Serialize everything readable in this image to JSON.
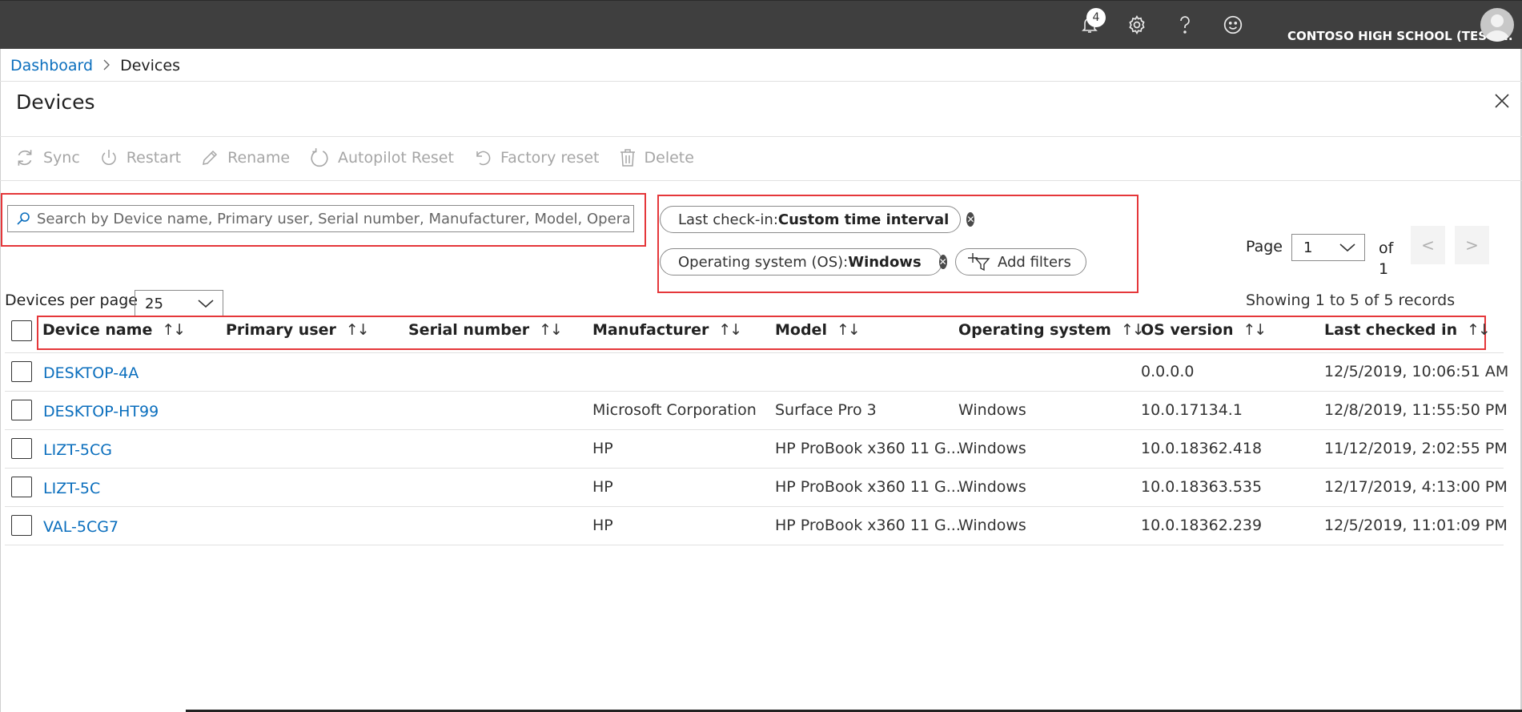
{
  "header": {
    "notification_count": "4",
    "tenant_name": "CONTOSO HIGH SCHOOL (TEST ...",
    "icons": [
      "bell-icon",
      "gear-icon",
      "help-icon",
      "smiley-icon",
      "avatar"
    ]
  },
  "breadcrumb": {
    "root": "Dashboard",
    "current": "Devices"
  },
  "page": {
    "title": "Devices"
  },
  "toolbar": {
    "sync": "Sync",
    "restart": "Restart",
    "rename": "Rename",
    "autopilot_reset": "Autopilot Reset",
    "factory_reset": "Factory reset",
    "delete": "Delete"
  },
  "search": {
    "placeholder": "Search by Device name, Primary user, Serial number, Manufacturer, Model, Opera..."
  },
  "filters": [
    {
      "label": "Last check-in:",
      "value": "Custom time interval"
    },
    {
      "label": "Operating system (OS):",
      "value": "Windows"
    }
  ],
  "add_filters_label": "Add filters",
  "pager": {
    "page_label": "Page",
    "current_page": "1",
    "of_label": "of",
    "total_pages": "1",
    "prev": "<",
    "next": ">",
    "records_text": "Showing 1 to 5 of 5 records"
  },
  "per_page": {
    "label": "Devices per page",
    "value": "25"
  },
  "table": {
    "columns": [
      "Device name",
      "Primary user",
      "Serial number",
      "Manufacturer",
      "Model",
      "Operating system",
      "OS version",
      "Last checked in"
    ],
    "sort_glyph": "↑↓",
    "rows": [
      {
        "device": "DESKTOP-4A",
        "user": "",
        "serial": "",
        "manufacturer": "",
        "model": "",
        "os": "",
        "os_version": "0.0.0.0",
        "last_checkin": "12/5/2019, 10:06:51 AM"
      },
      {
        "device": "DESKTOP-HT99",
        "user": "",
        "serial": "",
        "manufacturer": "Microsoft Corporation",
        "model": "Surface Pro 3",
        "os": "Windows",
        "os_version": "10.0.17134.1",
        "last_checkin": "12/8/2019, 11:55:50 PM"
      },
      {
        "device": "LIZT-5CG",
        "user": "",
        "serial": "",
        "manufacturer": "HP",
        "model": "HP ProBook x360 11 G...",
        "os": "Windows",
        "os_version": "10.0.18362.418",
        "last_checkin": "11/12/2019, 2:02:55 PM"
      },
      {
        "device": "LIZT-5C",
        "user": "",
        "serial": "",
        "manufacturer": "HP",
        "model": "HP ProBook x360 11 G...",
        "os": "Windows",
        "os_version": "10.0.18363.535",
        "last_checkin": "12/17/2019, 4:13:00 PM"
      },
      {
        "device": "VAL-5CG7",
        "user": "",
        "serial": "",
        "manufacturer": "HP",
        "model": "HP ProBook x360 11 G...",
        "os": "Windows",
        "os_version": "10.0.18362.239",
        "last_checkin": "12/5/2019, 11:01:09 PM"
      }
    ]
  },
  "colors": {
    "header_bg": "#3f3f3f",
    "link": "#0a6ebd",
    "highlight_box": "#e5373a",
    "disabled_text": "#a6a6a6"
  }
}
